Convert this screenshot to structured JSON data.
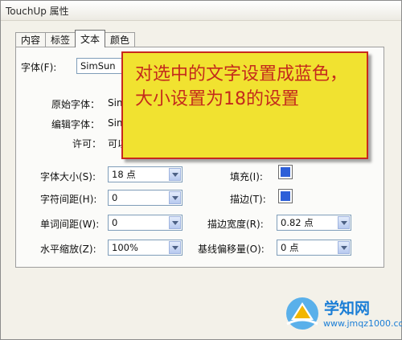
{
  "window": {
    "title": "TouchUp 属性"
  },
  "tabs": [
    {
      "label": "内容"
    },
    {
      "label": "标签"
    },
    {
      "label": "文本"
    },
    {
      "label": "颜色"
    }
  ],
  "font": {
    "label": "字体(F):",
    "value": "SimSun"
  },
  "info": {
    "original_font_label": "原始字体：",
    "original_font_value": "Sim",
    "edit_font_label": "编辑字体：",
    "edit_font_value": "Sim",
    "permission_label": "许可：",
    "permission_value": "可以"
  },
  "fields": {
    "font_size": {
      "label": "字体大小(S):",
      "value": "18 点"
    },
    "char_spacing": {
      "label": "字符间距(H):",
      "value": "0"
    },
    "word_spacing": {
      "label": "单词间距(W):",
      "value": "0"
    },
    "horiz_scale": {
      "label": "水平缩放(Z):",
      "value": "100%"
    },
    "fill": {
      "label": "填充(I):",
      "color": "#2d5fd8"
    },
    "stroke": {
      "label": "描边(T):",
      "color": "#2d5fd8"
    },
    "stroke_width": {
      "label": "描边宽度(R):",
      "value": "0.82 点"
    },
    "baseline_offset": {
      "label": "基线偏移量(O):",
      "value": "0 点"
    }
  },
  "callout": {
    "text": "对选中的文字设置成蓝色，大小设置为18的设置",
    "bg_color": "#f1e230",
    "text_color": "#c42a1c"
  },
  "watermark": {
    "name": "学知网",
    "url": "www.jmqz1000.com"
  }
}
